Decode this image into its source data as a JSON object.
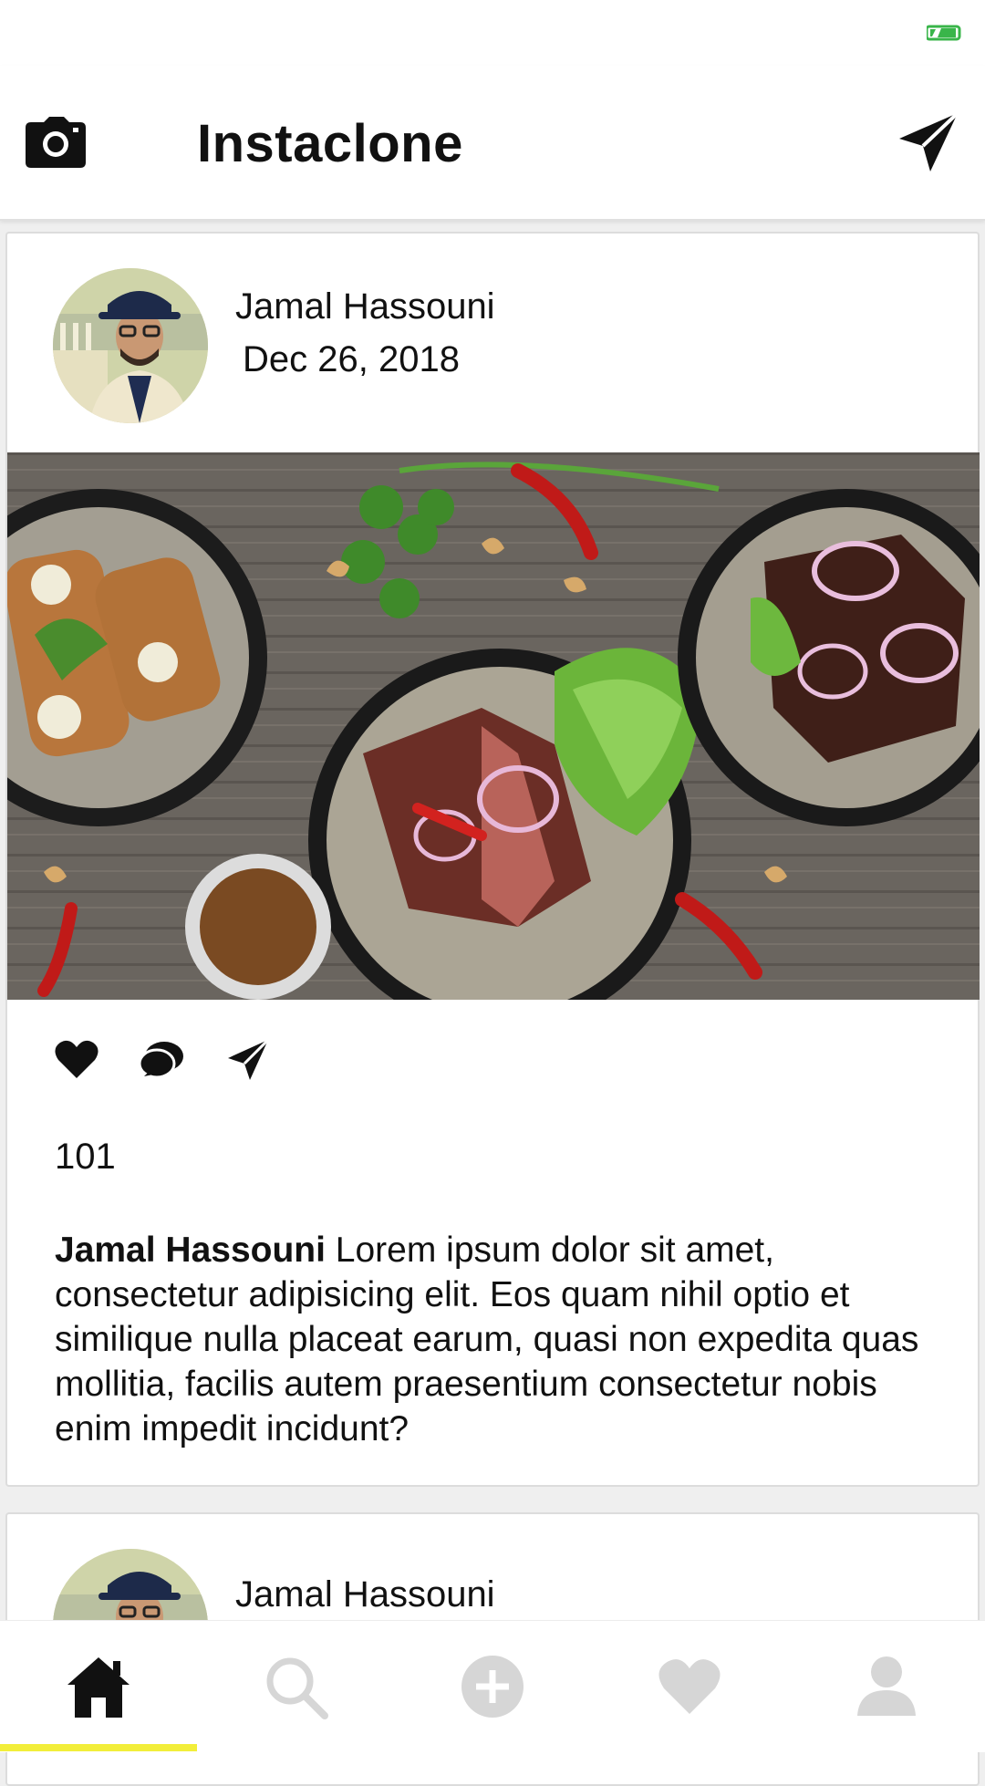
{
  "app": {
    "title": "Instaclone"
  },
  "colors": {
    "accent": "#f2ee3a",
    "battery": "#39b54a",
    "icon_active": "#111111",
    "icon_inactive": "#d6d6d6"
  },
  "header": {
    "camera_icon": "camera-icon",
    "send_icon": "send-icon"
  },
  "posts": [
    {
      "author": "Jamal Hassouni",
      "date": "Dec 26, 2018",
      "image": "food-bowls-photo",
      "likes": "101",
      "caption_author": "Jamal Hassouni",
      "caption_text": " Lorem ipsum dolor sit amet, consectetur adipisicing elit. Eos quam nihil optio et similique nulla placeat earum, quasi non expedita quas mollitia, facilis autem praesentium consectetur nobis enim impedit incidunt?"
    },
    {
      "author": "Jamal Hassouni"
    }
  ],
  "post_actions": [
    "heart-icon",
    "comment-icon",
    "share-icon"
  ],
  "bottom_nav": [
    {
      "name": "home",
      "icon": "home-icon",
      "active": true
    },
    {
      "name": "search",
      "icon": "search-icon",
      "active": false
    },
    {
      "name": "add",
      "icon": "plus-circle-icon",
      "active": false
    },
    {
      "name": "activity",
      "icon": "heart-icon",
      "active": false
    },
    {
      "name": "profile",
      "icon": "user-icon",
      "active": false
    }
  ]
}
